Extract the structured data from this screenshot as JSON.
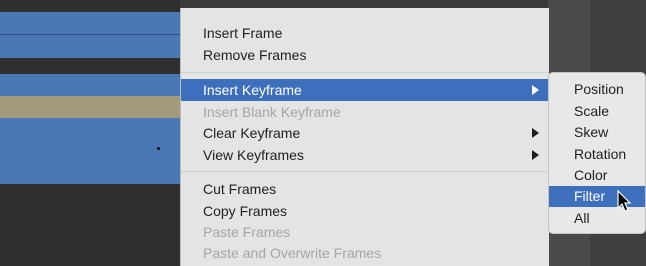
{
  "context_menu": {
    "items": [
      {
        "label": "Insert Frame",
        "state": "enabled"
      },
      {
        "label": "Remove Frames",
        "state": "enabled"
      },
      {
        "label": "Insert Keyframe",
        "state": "selected",
        "submenu": true
      },
      {
        "label": "Insert Blank Keyframe",
        "state": "disabled"
      },
      {
        "label": "Clear Keyframe",
        "state": "enabled",
        "submenu": true
      },
      {
        "label": "View Keyframes",
        "state": "enabled",
        "submenu": true
      },
      {
        "label": "Cut Frames",
        "state": "enabled"
      },
      {
        "label": "Copy Frames",
        "state": "enabled"
      },
      {
        "label": "Paste Frames",
        "state": "disabled"
      },
      {
        "label": "Paste and Overwrite Frames",
        "state": "disabled"
      }
    ]
  },
  "submenu": {
    "items": [
      {
        "label": "Position"
      },
      {
        "label": "Scale"
      },
      {
        "label": "Skew"
      },
      {
        "label": "Rotation"
      },
      {
        "label": "Color"
      },
      {
        "label": "Filter",
        "state": "selected"
      },
      {
        "label": "All"
      }
    ]
  },
  "colors": {
    "highlight": "#3e6fbd",
    "menu_bg": "#e4e4e4",
    "disabled_text": "#a6a6a6",
    "layer_blue": "#4a78b4",
    "layer_tan": "#a39a7c"
  }
}
